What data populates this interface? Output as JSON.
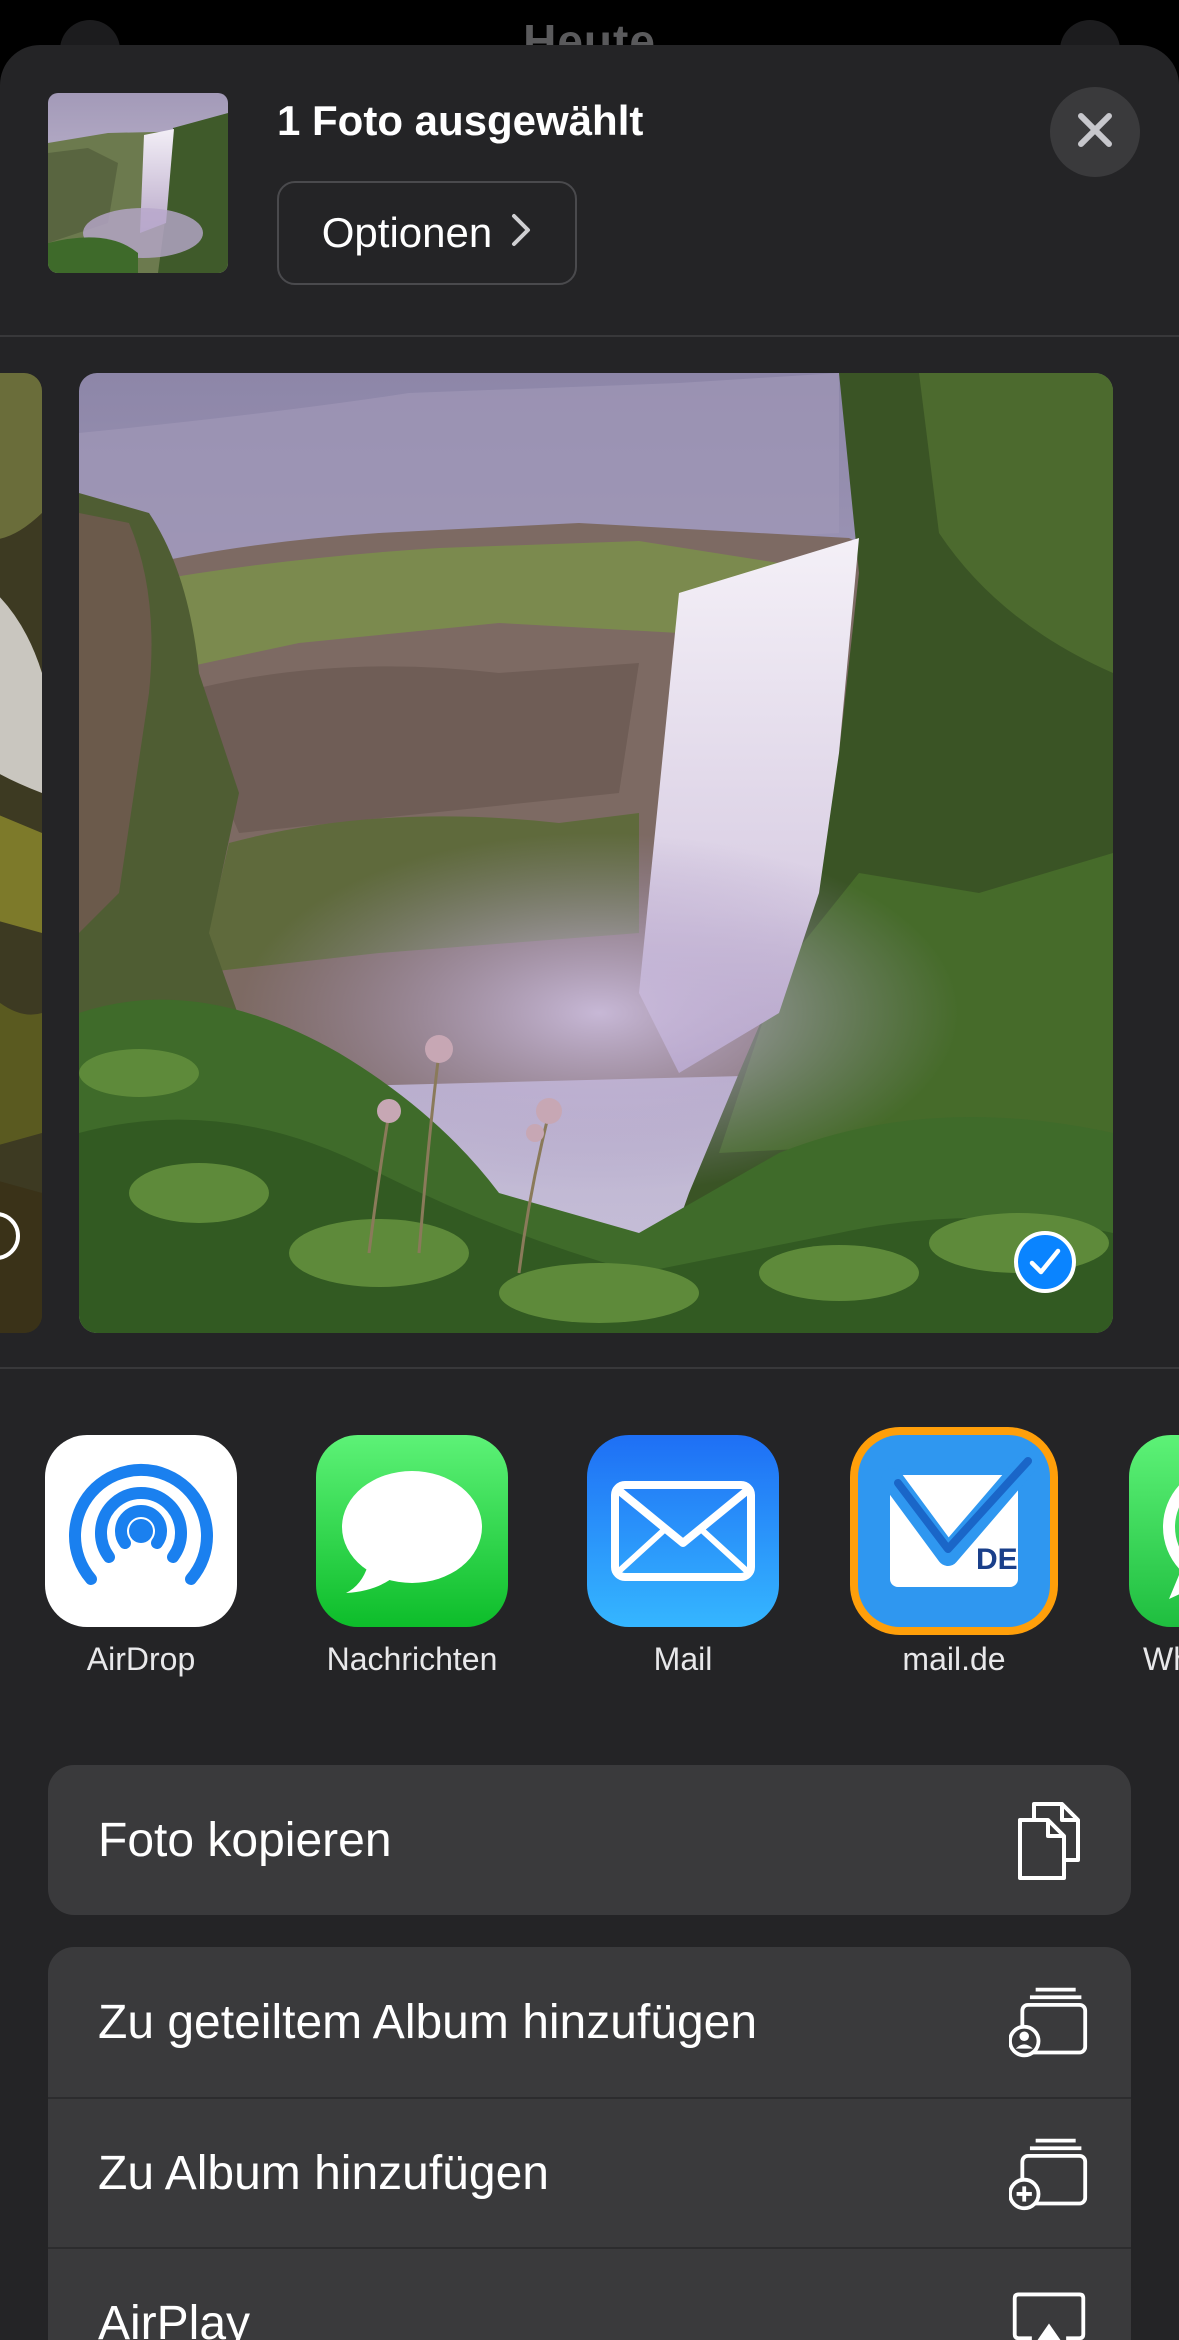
{
  "background": {
    "title": "Heute"
  },
  "header": {
    "title": "1 Foto ausgewählt",
    "options_label": "Optionen"
  },
  "apps": [
    {
      "label": "AirDrop",
      "icon": "airdrop-icon"
    },
    {
      "label": "Nachrichten",
      "icon": "messages-icon"
    },
    {
      "label": "Mail",
      "icon": "mail-icon"
    },
    {
      "label": "mail.de",
      "icon": "mailde-icon",
      "badge": "DE"
    },
    {
      "label": "Wh",
      "icon": "whatsapp-icon"
    }
  ],
  "actions_group1": [
    {
      "label": "Foto kopieren",
      "icon": "copy-icon"
    }
  ],
  "actions_group2": [
    {
      "label": "Zu geteiltem Album hinzufügen",
      "icon": "shared-album-icon"
    },
    {
      "label": "Zu Album hinzufügen",
      "icon": "add-album-icon"
    },
    {
      "label": "AirPlay",
      "icon": "airplay-icon"
    }
  ],
  "colors": {
    "sheet": "#242426",
    "accent_blue": "#0a84ff",
    "selection_orange": "#ff9f0a",
    "messages_green": "#2fd158",
    "mail_blue": "#1a8cff"
  }
}
